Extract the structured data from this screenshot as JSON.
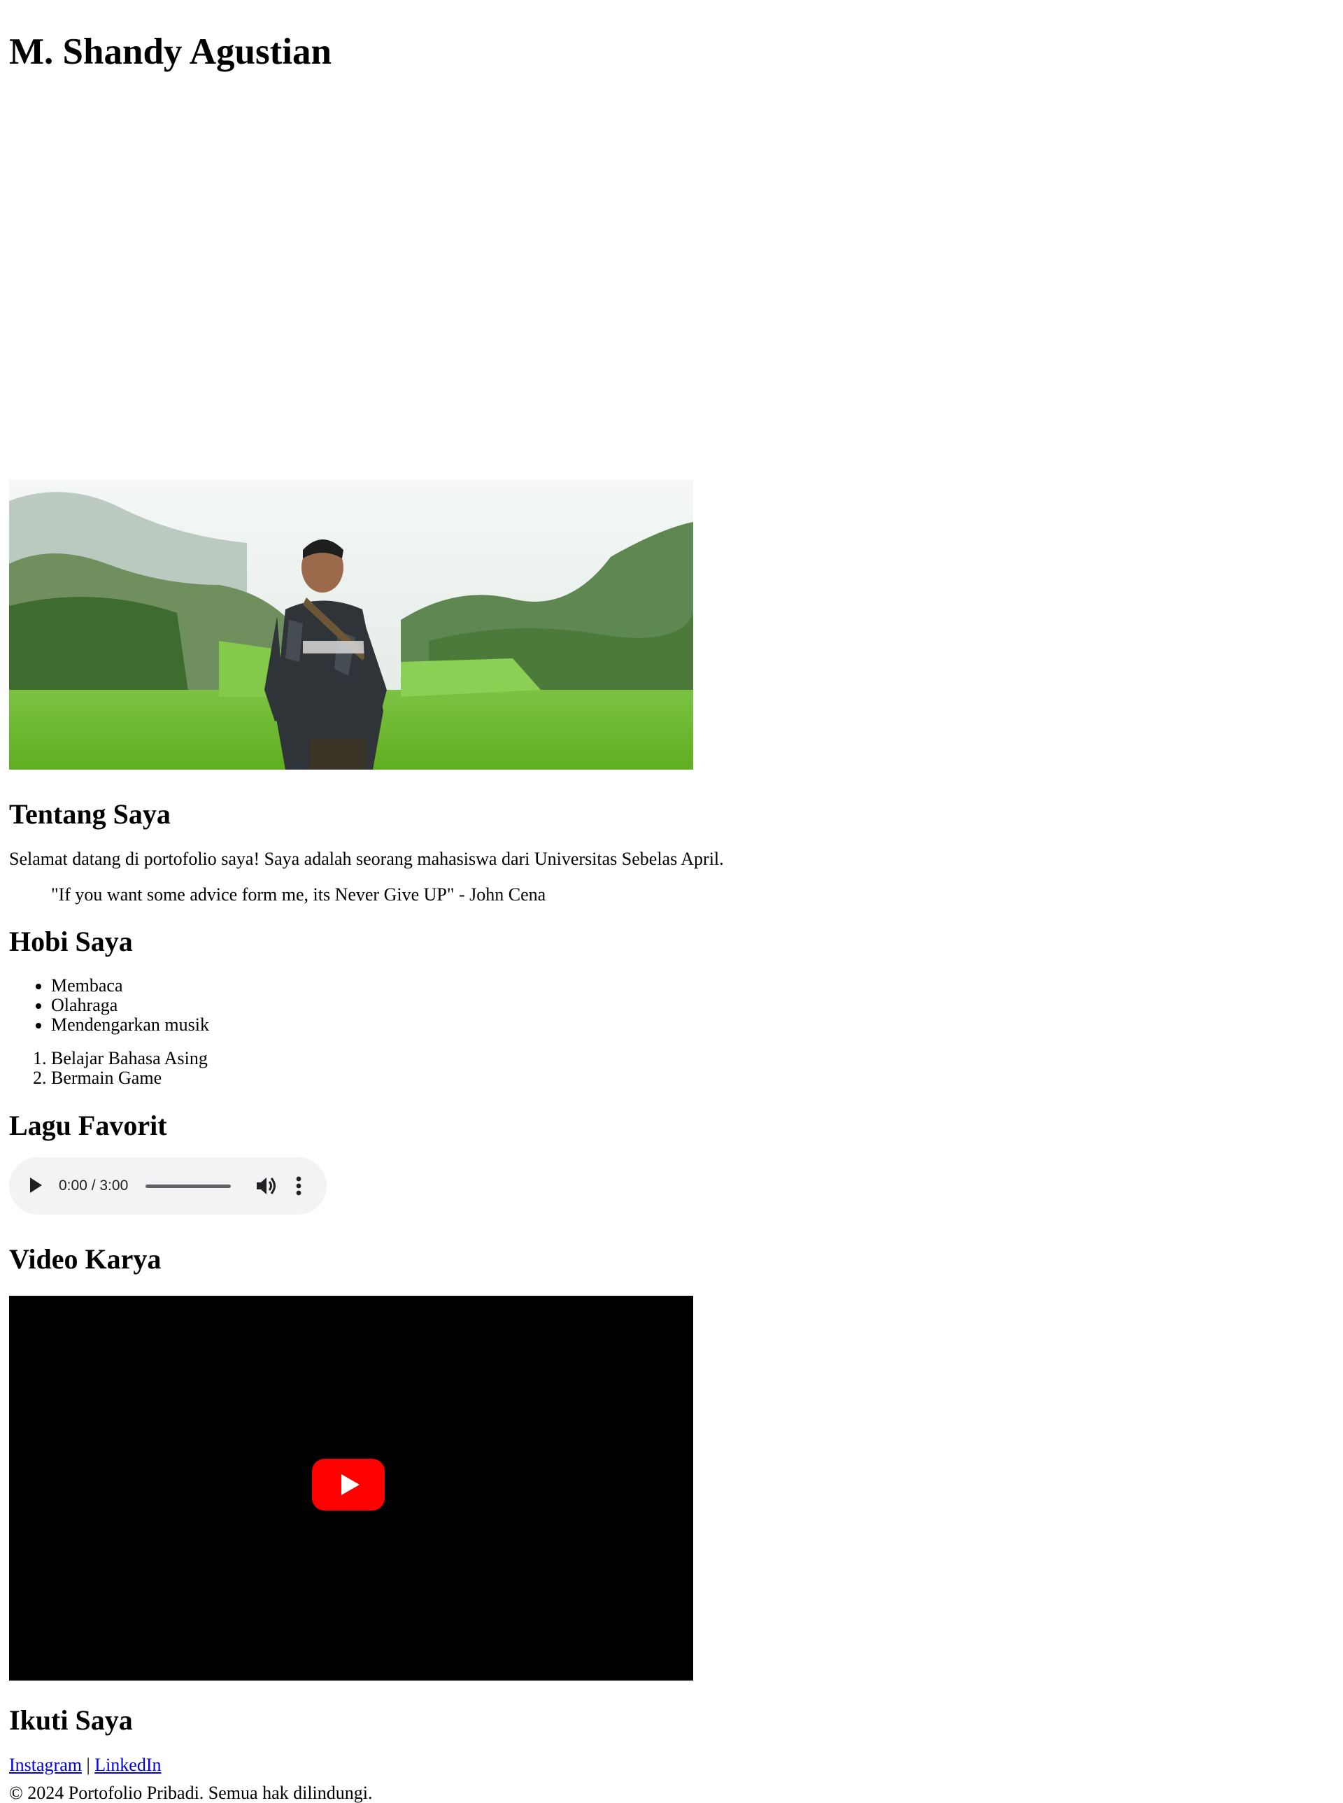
{
  "header": {
    "title": "M. Shandy Agustian"
  },
  "about": {
    "heading": "Tentang Saya",
    "paragraph": "Selamat datang di portofolio saya! Saya adalah seorang mahasiswa dari Universitas Sebelas April.",
    "quote": "\"If you want some advice form me, its Never Give UP\" - John Cena"
  },
  "hobbies": {
    "heading": "Hobi Saya",
    "bullet_items": [
      "Membaca",
      "Olahraga",
      "Mendengarkan musik"
    ],
    "numbered_items": [
      "Belajar Bahasa Asing",
      "Bermain Game"
    ]
  },
  "song": {
    "heading": "Lagu Favorit",
    "time": "0:00 / 3:00",
    "progress": 0,
    "icons": {
      "play": "play-icon",
      "volume": "volume-icon",
      "more": "more-options-icon"
    }
  },
  "video": {
    "heading": "Video Karya",
    "icon": "youtube-play-icon",
    "background": "#000000",
    "button_color": "#ff0000"
  },
  "follow": {
    "heading": "Ikuti Saya",
    "links": [
      "Instagram",
      "LinkedIn"
    ],
    "separator": "|"
  },
  "footer": {
    "copyright": "© 2024 Portofolio Pribadi. Semua hak dilindungi."
  },
  "colors": {
    "link": "#0000ee",
    "audio_bg": "#f1f3f4"
  }
}
